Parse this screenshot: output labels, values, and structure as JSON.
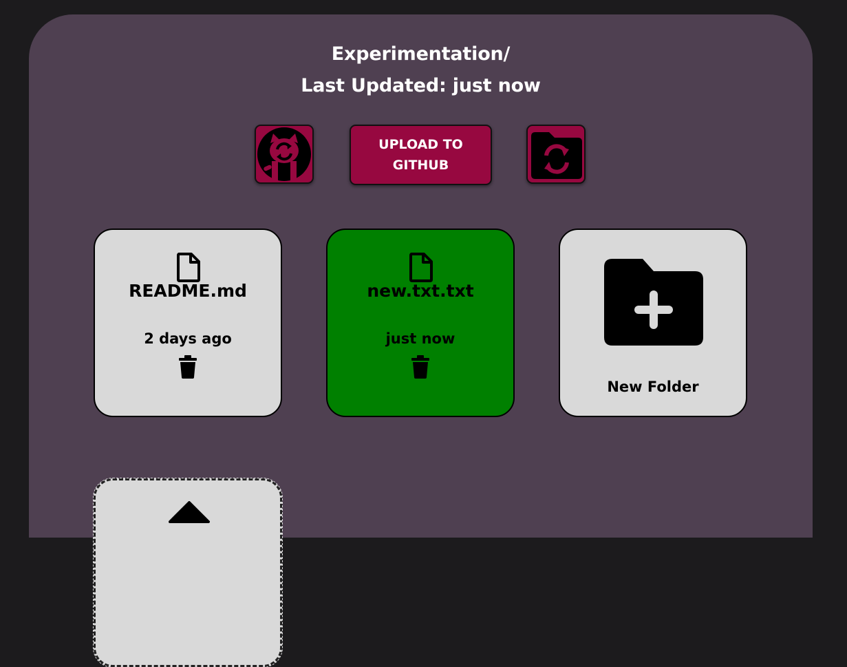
{
  "header": {
    "path": "Experimentation/",
    "updated_prefix": "Last Updated:",
    "updated_value": "just now"
  },
  "toolbar": {
    "github_sync_icon": "github-sync-icon",
    "upload_label": "UPLOAD TO GITHUB",
    "refresh_icon": "folder-refresh-icon"
  },
  "files": [
    {
      "name": "README.md",
      "updated": "2 days ago",
      "icon": "file-icon",
      "color": "#d9d9d9"
    },
    {
      "name": "new.txt.txt",
      "updated": "just now",
      "icon": "file-icon",
      "color": "#008000"
    }
  ],
  "new_folder": {
    "label": "New Folder",
    "icon": "folder-plus-icon"
  },
  "upload_card": {
    "icon": "upload-arrow-icon"
  },
  "colors": {
    "page_background": "#1c1b1d",
    "panel_background": "#4f4051",
    "accent": "#970840",
    "card_background": "#d9d9d9",
    "highlight_card": "#008000"
  }
}
